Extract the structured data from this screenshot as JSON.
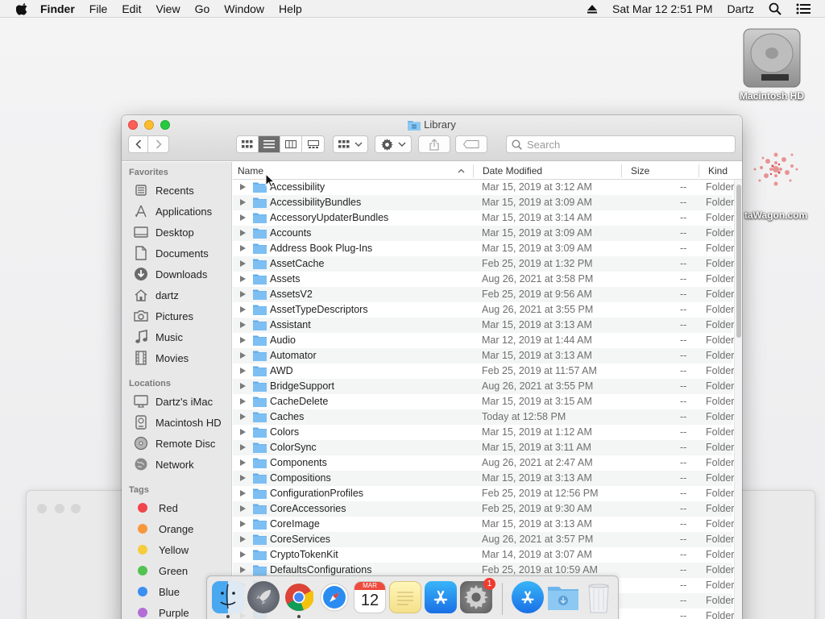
{
  "menubar": {
    "app_name": "Finder",
    "items": [
      "File",
      "Edit",
      "View",
      "Go",
      "Window",
      "Help"
    ],
    "datetime": "Sat Mar 12  2:51 PM",
    "user": "Dartz"
  },
  "desktop": {
    "hd_label": "Macintosh HD",
    "second_label": "taWagon.com"
  },
  "window": {
    "title": "Library",
    "search_placeholder": "Search"
  },
  "sidebar": {
    "favorites_header": "Favorites",
    "favorites": [
      "Recents",
      "Applications",
      "Desktop",
      "Documents",
      "Downloads",
      "dartz",
      "Pictures",
      "Music",
      "Movies"
    ],
    "locations_header": "Locations",
    "locations": [
      "Dartz's iMac",
      "Macintosh HD",
      "Remote Disc",
      "Network"
    ],
    "tags_header": "Tags",
    "tags": [
      {
        "label": "Red",
        "color": "#f0454a"
      },
      {
        "label": "Orange",
        "color": "#f6983b"
      },
      {
        "label": "Yellow",
        "color": "#f5cc3b"
      },
      {
        "label": "Green",
        "color": "#52c251"
      },
      {
        "label": "Blue",
        "color": "#3a8ff0"
      },
      {
        "label": "Purple",
        "color": "#b36dd6"
      }
    ]
  },
  "columns": {
    "name": "Name",
    "date": "Date Modified",
    "size": "Size",
    "kind": "Kind"
  },
  "rows": [
    {
      "name": "Accessibility",
      "date": "Mar 15, 2019 at 3:12 AM",
      "size": "--",
      "kind": "Folder"
    },
    {
      "name": "AccessibilityBundles",
      "date": "Mar 15, 2019 at 3:09 AM",
      "size": "--",
      "kind": "Folder"
    },
    {
      "name": "AccessoryUpdaterBundles",
      "date": "Mar 15, 2019 at 3:14 AM",
      "size": "--",
      "kind": "Folder"
    },
    {
      "name": "Accounts",
      "date": "Mar 15, 2019 at 3:09 AM",
      "size": "--",
      "kind": "Folder"
    },
    {
      "name": "Address Book Plug-Ins",
      "date": "Mar 15, 2019 at 3:09 AM",
      "size": "--",
      "kind": "Folder"
    },
    {
      "name": "AssetCache",
      "date": "Feb 25, 2019 at 1:32 PM",
      "size": "--",
      "kind": "Folder"
    },
    {
      "name": "Assets",
      "date": "Aug 26, 2021 at 3:58 PM",
      "size": "--",
      "kind": "Folder"
    },
    {
      "name": "AssetsV2",
      "date": "Feb 25, 2019 at 9:56 AM",
      "size": "--",
      "kind": "Folder"
    },
    {
      "name": "AssetTypeDescriptors",
      "date": "Aug 26, 2021 at 3:55 PM",
      "size": "--",
      "kind": "Folder"
    },
    {
      "name": "Assistant",
      "date": "Mar 15, 2019 at 3:13 AM",
      "size": "--",
      "kind": "Folder"
    },
    {
      "name": "Audio",
      "date": "Mar 12, 2019 at 1:44 AM",
      "size": "--",
      "kind": "Folder"
    },
    {
      "name": "Automator",
      "date": "Mar 15, 2019 at 3:13 AM",
      "size": "--",
      "kind": "Folder"
    },
    {
      "name": "AWD",
      "date": "Feb 25, 2019 at 11:57 AM",
      "size": "--",
      "kind": "Folder"
    },
    {
      "name": "BridgeSupport",
      "date": "Aug 26, 2021 at 3:55 PM",
      "size": "--",
      "kind": "Folder"
    },
    {
      "name": "CacheDelete",
      "date": "Mar 15, 2019 at 3:15 AM",
      "size": "--",
      "kind": "Folder"
    },
    {
      "name": "Caches",
      "date": "Today at 12:58 PM",
      "size": "--",
      "kind": "Folder"
    },
    {
      "name": "Colors",
      "date": "Mar 15, 2019 at 1:12 AM",
      "size": "--",
      "kind": "Folder"
    },
    {
      "name": "ColorSync",
      "date": "Mar 15, 2019 at 3:11 AM",
      "size": "--",
      "kind": "Folder"
    },
    {
      "name": "Components",
      "date": "Aug 26, 2021 at 2:47 AM",
      "size": "--",
      "kind": "Folder"
    },
    {
      "name": "Compositions",
      "date": "Mar 15, 2019 at 3:13 AM",
      "size": "--",
      "kind": "Folder"
    },
    {
      "name": "ConfigurationProfiles",
      "date": "Feb 25, 2019 at 12:56 PM",
      "size": "--",
      "kind": "Folder"
    },
    {
      "name": "CoreAccessories",
      "date": "Feb 25, 2019 at 9:30 AM",
      "size": "--",
      "kind": "Folder"
    },
    {
      "name": "CoreImage",
      "date": "Mar 15, 2019 at 3:13 AM",
      "size": "--",
      "kind": "Folder"
    },
    {
      "name": "CoreServices",
      "date": "Aug 26, 2021 at 3:57 PM",
      "size": "--",
      "kind": "Folder"
    },
    {
      "name": "CryptoTokenKit",
      "date": "Mar 14, 2019 at 3:07 AM",
      "size": "--",
      "kind": "Folder"
    },
    {
      "name": "DefaultsConfigurations",
      "date": "Feb 25, 2019 at 10:59 AM",
      "size": "--",
      "kind": "Folder"
    },
    {
      "name": "",
      "date": "",
      "size": "--",
      "kind": "Folder"
    },
    {
      "name": "",
      "date": "",
      "size": "--",
      "kind": "Folder"
    },
    {
      "name": "",
      "date": "",
      "size": "--",
      "kind": "Folder"
    }
  ],
  "dock": {
    "calendar_month": "MAR",
    "calendar_day": "12",
    "settings_badge": "1"
  }
}
